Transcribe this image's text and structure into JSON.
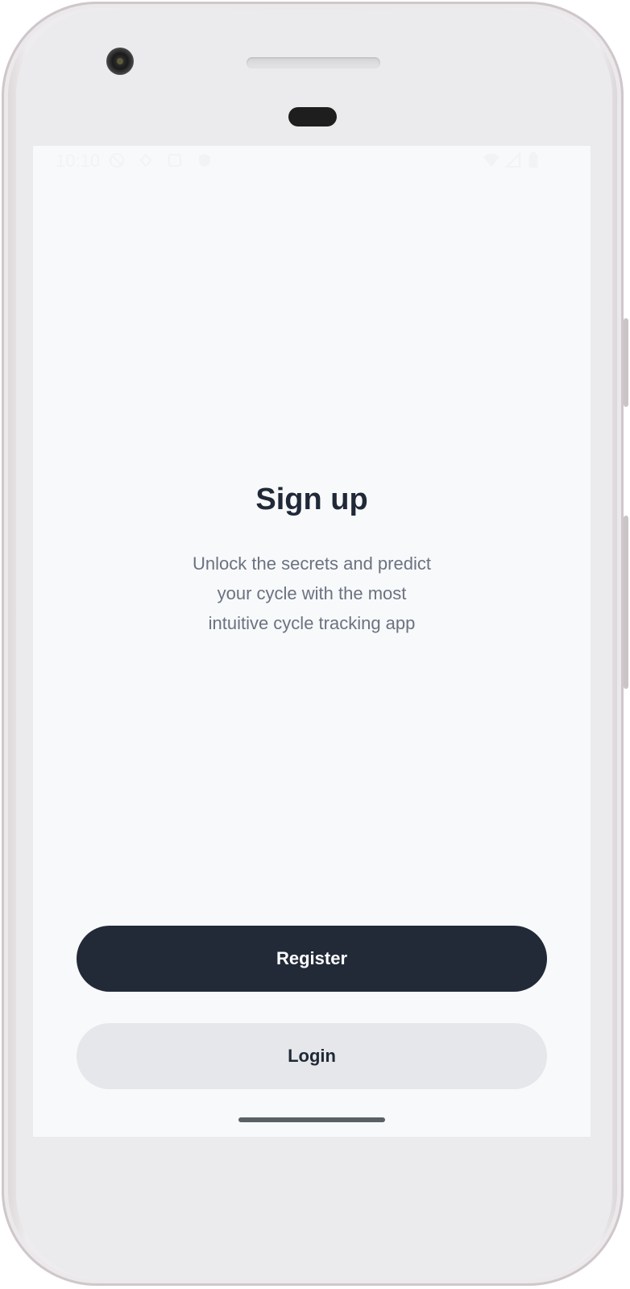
{
  "status_bar": {
    "time": "10:10",
    "icons": [
      "do-not-disturb-icon",
      "location-icon",
      "notification-icon",
      "shield-icon",
      "wifi-icon",
      "signal-icon",
      "battery-icon"
    ]
  },
  "signup": {
    "title": "Sign up",
    "subtitle_line1": "Unlock the secrets and predict",
    "subtitle_line2": "your cycle with the most",
    "subtitle_line3": "intuitive cycle tracking app"
  },
  "actions": {
    "register_label": "Register",
    "login_label": "Login"
  },
  "colors": {
    "primary": "#222a38",
    "secondary": "#e6e7ea",
    "background": "#f8f9fb",
    "text_primary": "#1f2937",
    "text_secondary": "#6b7280"
  }
}
